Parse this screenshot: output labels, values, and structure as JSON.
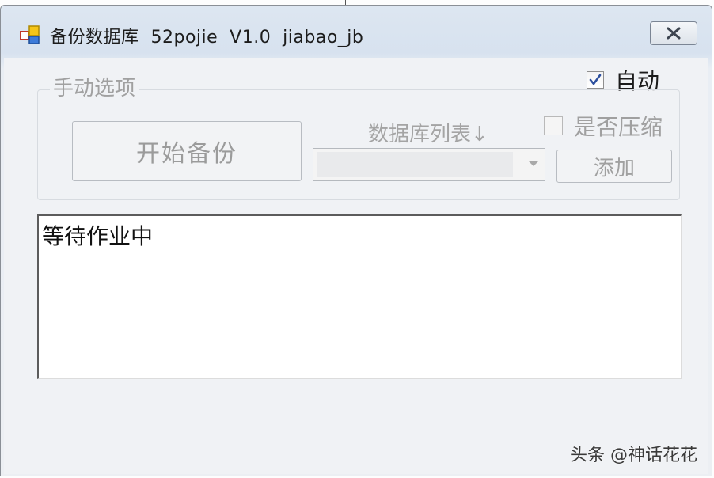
{
  "window": {
    "title": "备份数据库  52pojie  V1.0  jiabao_jb",
    "icon": "app-window-icon",
    "close_icon": "close-icon"
  },
  "options": {
    "auto_label": "自动",
    "auto_checked": true
  },
  "manual_group": {
    "title": "手动选项",
    "start_button": "开始备份",
    "db_list_label": "数据库列表↓",
    "db_select_value": "",
    "compress_label": "是否压缩",
    "compress_checked": false,
    "add_button": "添加"
  },
  "log": {
    "text": "等待作业中"
  },
  "watermark": "头条 @神话花花",
  "colors": {
    "title_bar": "#dde6f1",
    "client_bg": "#f0f2f5",
    "disabled_text": "#a0a0a0"
  }
}
